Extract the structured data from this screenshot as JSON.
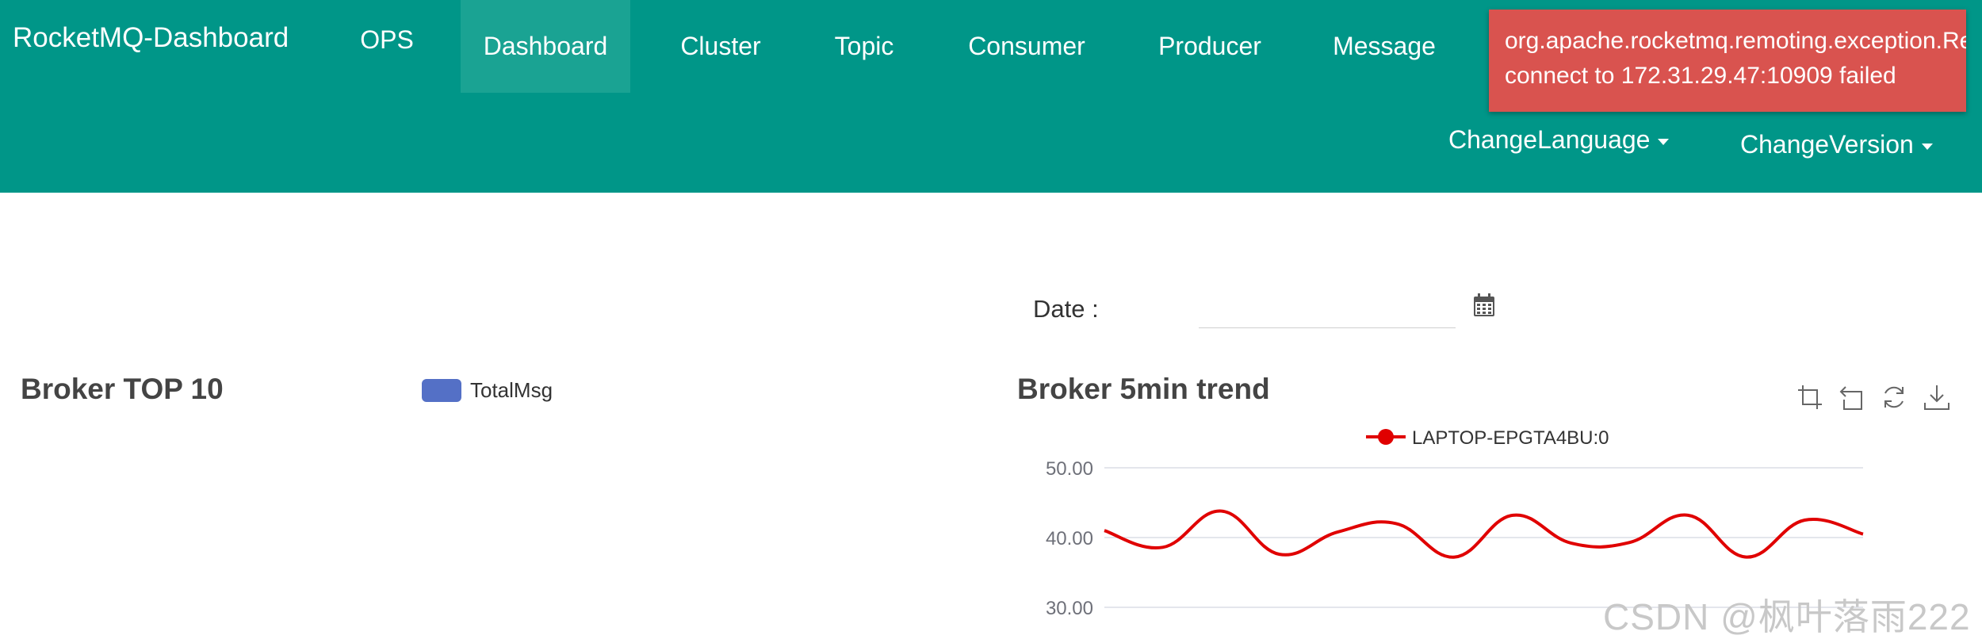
{
  "navbar": {
    "brand": "RocketMQ-Dashboard",
    "items": [
      {
        "label": "OPS"
      },
      {
        "label": "Dashboard",
        "active": true
      },
      {
        "label": "Cluster"
      },
      {
        "label": "Topic"
      },
      {
        "label": "Consumer"
      },
      {
        "label": "Producer"
      },
      {
        "label": "Message"
      }
    ],
    "change_language": "ChangeLanguage",
    "change_version": "ChangeVersion",
    "background_color": "#009688",
    "active_color": "#1aa393"
  },
  "alert": {
    "line1": "org.apache.rocketmq.remoting.exception.RemotingConnectException:",
    "line2": "connect to 172.31.29.47:10909 failed",
    "color": "#d9534f"
  },
  "date_filter": {
    "label": "Date :",
    "value": "",
    "icon": "calendar-icon"
  },
  "broker_top10": {
    "title": "Broker TOP 10",
    "legend": "TotalMsg",
    "legend_color": "#5470c6"
  },
  "broker_trend": {
    "title": "Broker 5min trend",
    "toolbox": [
      "zoom-icon",
      "zoom-reset-icon",
      "restore-icon",
      "download-icon"
    ]
  },
  "chart_data": {
    "type": "line",
    "title": "Broker 5min trend",
    "xlabel": "",
    "ylabel": "",
    "ylim": [
      30,
      50
    ],
    "yticks": [
      "50.00",
      "40.00",
      "30.00"
    ],
    "grid": true,
    "legend": "top-center",
    "series": [
      {
        "name": "LAPTOP-EPGTA4BU:0",
        "color": "#e00000",
        "values": [
          41.0,
          38.6,
          43.8,
          37.6,
          40.8,
          42.0,
          37.2,
          43.2,
          39.2,
          39.3,
          43.2,
          37.2,
          42.5,
          40.5
        ]
      }
    ]
  },
  "watermark": "CSDN @枫叶落雨222"
}
